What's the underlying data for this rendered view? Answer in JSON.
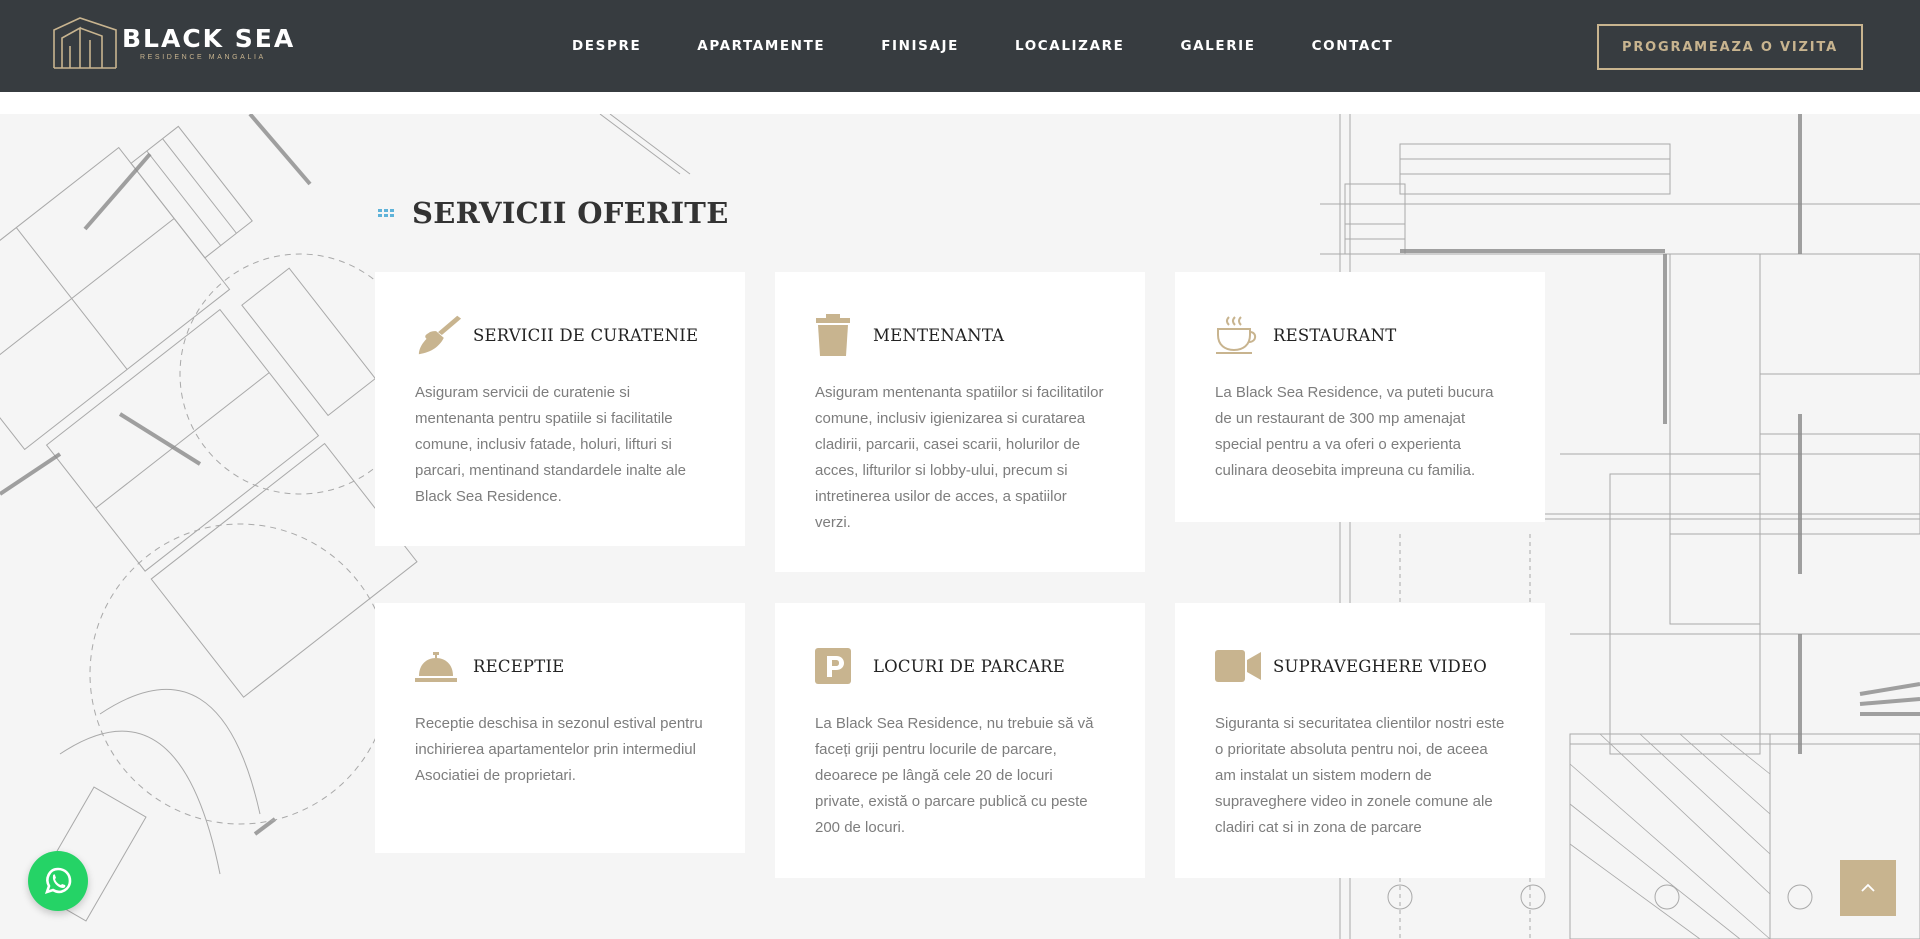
{
  "header": {
    "logo_title": "BLACK SEA",
    "logo_subtitle": "RESIDENCE MANGALIA",
    "nav": [
      "DESPRE",
      "APARTAMENTE",
      "FINISAJE",
      "LOCALIZARE",
      "GALERIE",
      "CONTACT"
    ],
    "cta_label": "PROGRAMEAZA O VIZITA"
  },
  "section": {
    "title": "SERVICII OFERITE"
  },
  "services": [
    {
      "icon": "broom-icon",
      "title": "SERVICII DE CURATENIE",
      "text": "Asiguram servicii de curatenie si mentenanta pentru spatiile si facilitatile comune, inclusiv fatade, holuri, lifturi si parcari, mentinand standardele inalte ale Black Sea Residence."
    },
    {
      "icon": "trash-icon",
      "title": "MENTENANTA",
      "text": "Asiguram mentenanta spatiilor si facilitatilor comune, inclusiv igienizarea si curatarea cladirii, parcarii, casei scarii, holurilor de acces, lifturilor si lobby-ului, precum si intretinerea usilor de acces, a spatiilor verzi."
    },
    {
      "icon": "coffee-cup-icon",
      "title": "RESTAURANT",
      "text": "La Black Sea Residence, va puteti bucura de un restaurant de 300 mp amenajat special pentru a va oferi o experienta culinara deosebita impreuna cu familia."
    },
    {
      "icon": "reception-bell-icon",
      "title": "RECEPTIE",
      "text": "Receptie deschisa in sezonul estival pentru inchirierea apartamentelor prin intermediul Asociatiei de proprietari."
    },
    {
      "icon": "parking-icon",
      "title": "LOCURI DE PARCARE",
      "text": "La Black Sea Residence, nu trebuie să vă faceți griji pentru locurile de parcare, deoarece pe lângă cele 20 de locuri private, există o parcare publică cu peste 200 de locuri."
    },
    {
      "icon": "video-camera-icon",
      "title": "SUPRAVEGHERE VIDEO",
      "text": "Siguranta si securitatea clientilor nostri este o prioritate absoluta pentru noi, de aceea am instalat un sistem modern de supraveghere video in zonele comune ale cladiri cat si in zona de parcare"
    }
  ],
  "colors": {
    "header_bg": "#373c40",
    "accent_gold": "#c8b48f",
    "whatsapp_green": "#25d366",
    "title_dots_blue": "#5fb3d9"
  }
}
